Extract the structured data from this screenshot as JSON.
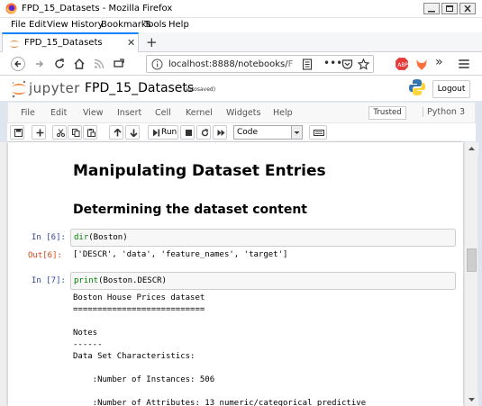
{
  "window": {
    "title": "FPD_15_Datasets - Mozilla Firefox"
  },
  "menubar": {
    "items": [
      "File",
      "Edit",
      "View",
      "History",
      "Bookmarks",
      "Tools",
      "Help"
    ]
  },
  "tab": {
    "title": "FPD_15_Datasets"
  },
  "navbar": {
    "url_main": "localhost:8888/notebooks/",
    "url_dim": "F"
  },
  "jupyter": {
    "logo_text": "jupyter",
    "notebook_name": "FPD_15_Datasets",
    "save_status": "(autosaved)",
    "logout_label": "Logout",
    "menu": [
      "File",
      "Edit",
      "View",
      "Insert",
      "Cell",
      "Kernel",
      "Widgets",
      "Help"
    ],
    "trusted_label": "Trusted",
    "kernel_label": "Python 3",
    "toolbar": {
      "run_label": "Run",
      "cell_type": "Code"
    }
  },
  "notebook": {
    "heading1": "Manipulating Dataset Entries",
    "heading2": "Determining the dataset content",
    "cell1": {
      "prompt_in": "In [6]:",
      "code_fn": "dir",
      "code_rest": "(Boston)",
      "prompt_out": "Out[6]:",
      "output": "['DESCR', 'data', 'feature_names', 'target']"
    },
    "cell2": {
      "prompt_in": "In [7]:",
      "code_fn": "print",
      "code_rest": "(Boston.DESCR)",
      "output": "Boston House Prices dataset\n===========================\n\nNotes\n------\nData Set Characteristics:\n\n    :Number of Instances: 506\n\n    :Number of Attributes: 13 numeric/categorical predictive"
    }
  },
  "colors": {
    "firefox_accent": "#0a84ff",
    "prompt_in": "#303f9f",
    "prompt_out": "#d84315",
    "code_builtin": "#008000"
  }
}
